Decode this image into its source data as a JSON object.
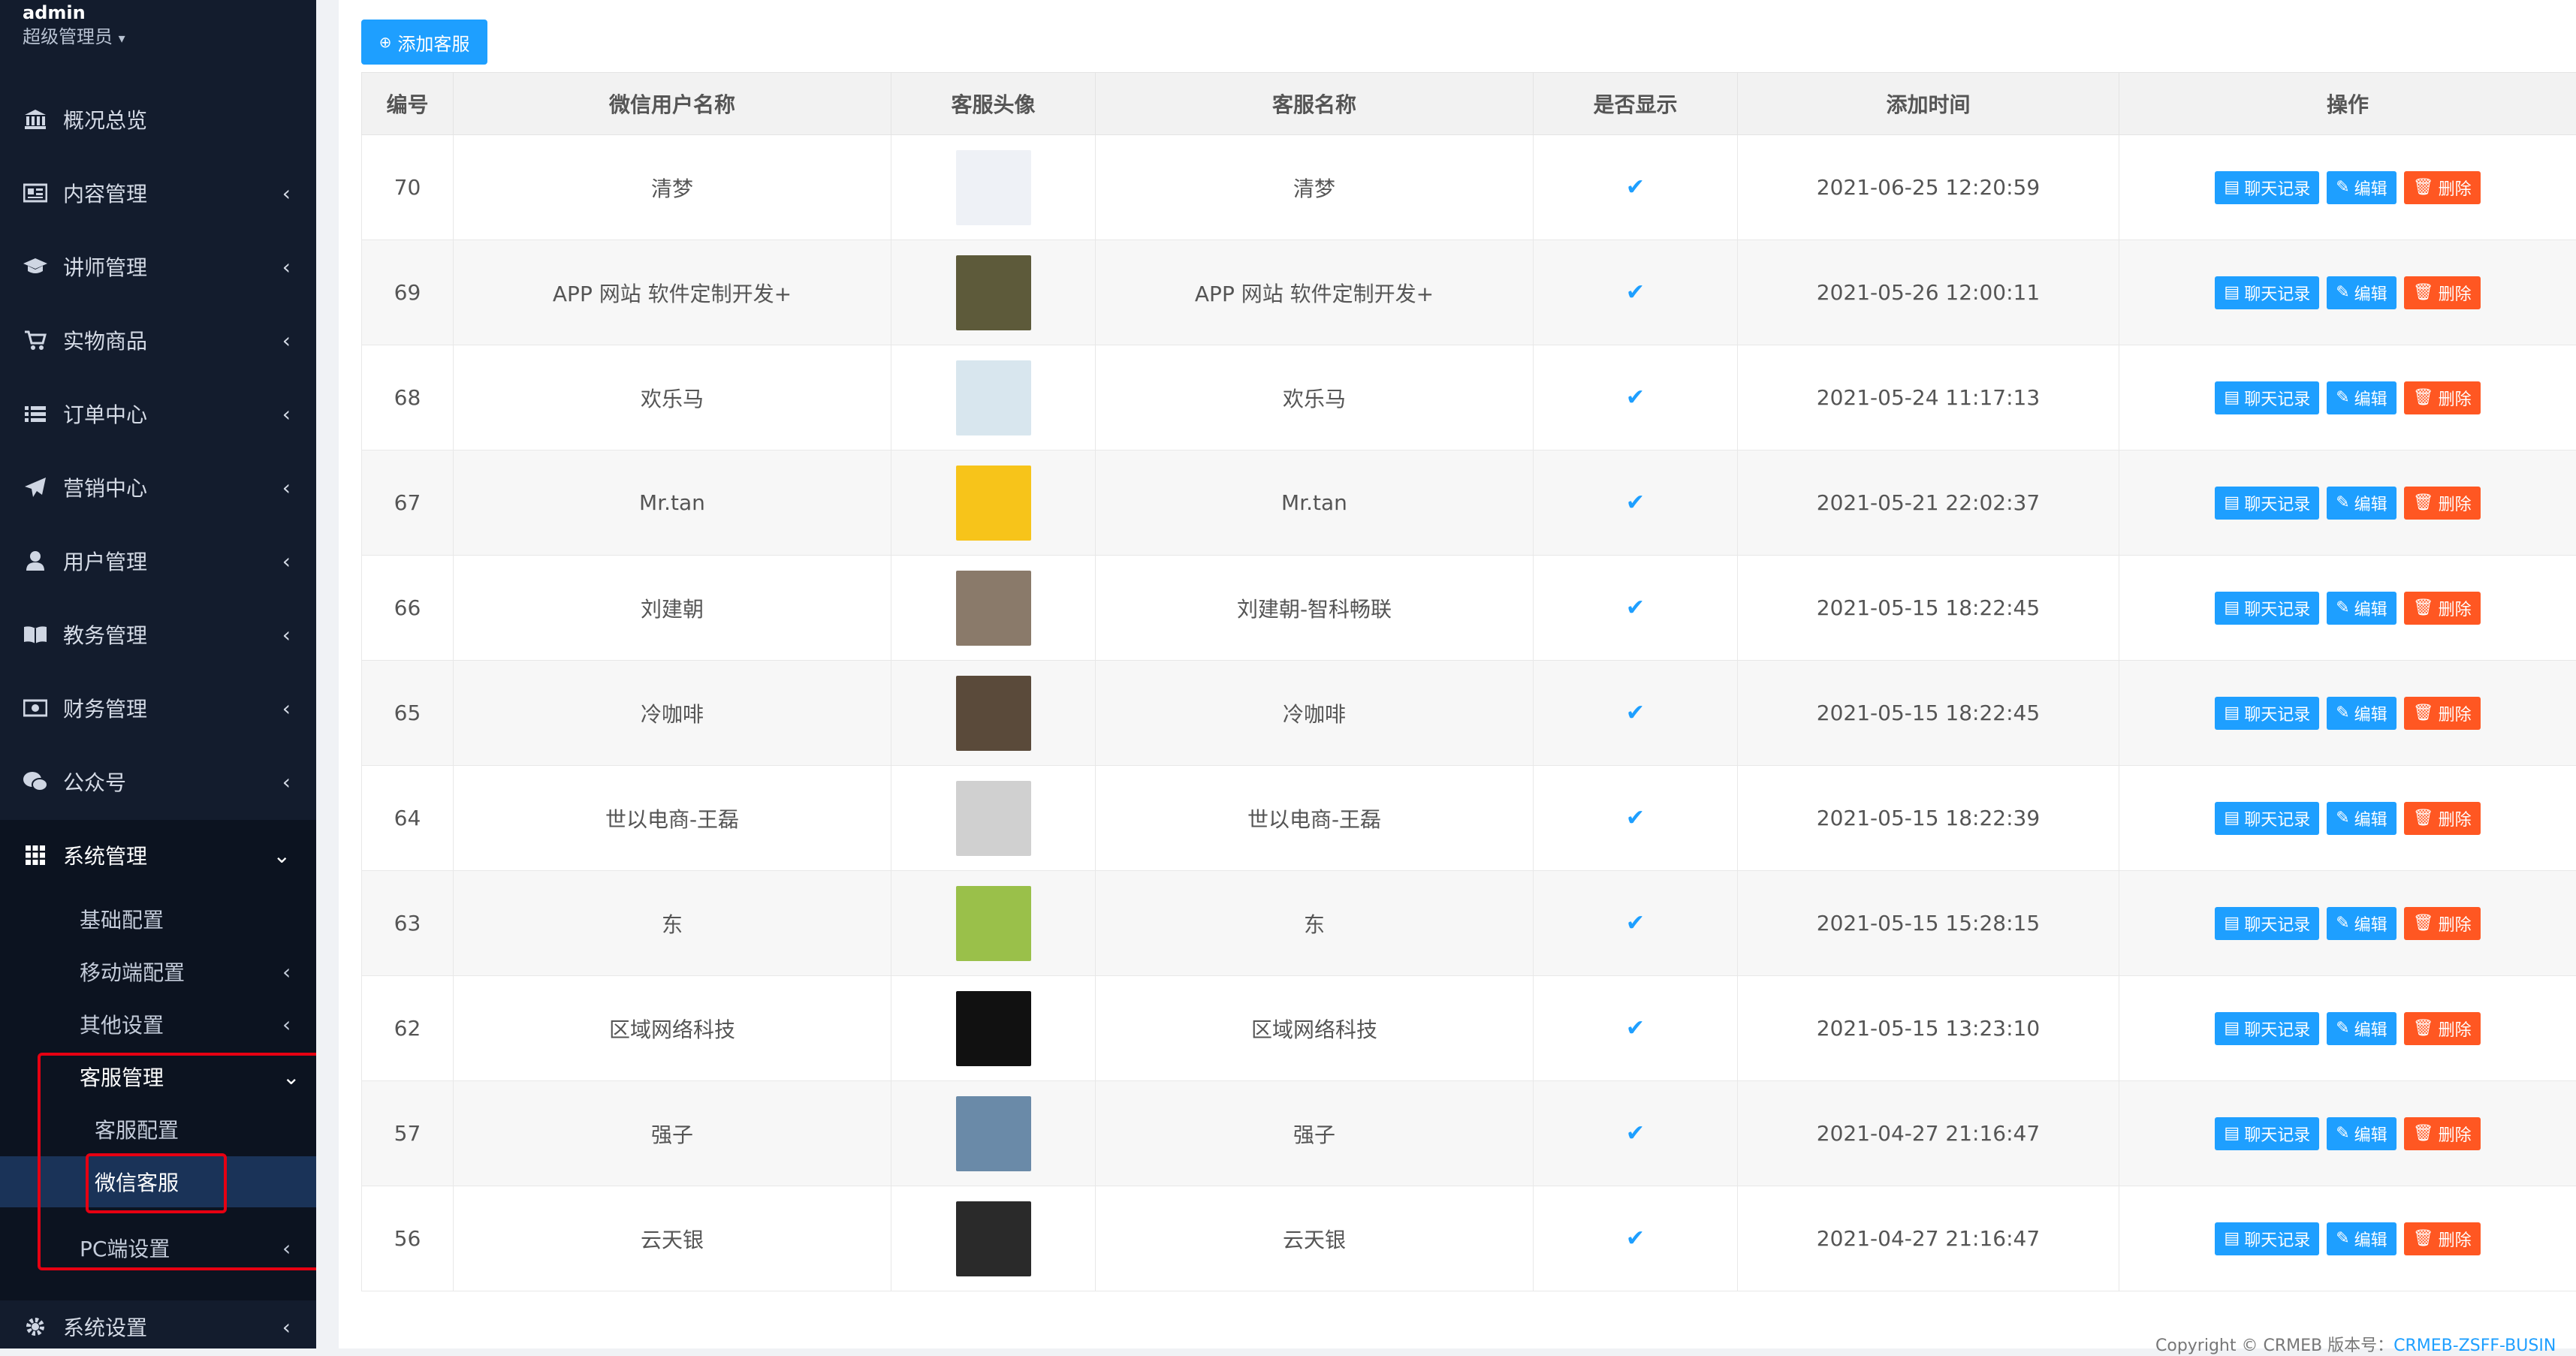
{
  "user": {
    "name": "admin",
    "role": "超级管理员"
  },
  "nav": [
    {
      "label": "概况总览",
      "icon": "bank-icon",
      "chevron": false
    },
    {
      "label": "内容管理",
      "icon": "newspaper-icon",
      "chevron": true
    },
    {
      "label": "讲师管理",
      "icon": "graduation-cap-icon",
      "chevron": true
    },
    {
      "label": "实物商品",
      "icon": "cart-icon",
      "chevron": true
    },
    {
      "label": "订单中心",
      "icon": "list-icon",
      "chevron": true
    },
    {
      "label": "营销中心",
      "icon": "paper-plane-icon",
      "chevron": true
    },
    {
      "label": "用户管理",
      "icon": "user-icon",
      "chevron": true
    },
    {
      "label": "教务管理",
      "icon": "book-icon",
      "chevron": true
    },
    {
      "label": "财务管理",
      "icon": "money-icon",
      "chevron": true
    },
    {
      "label": "公众号",
      "icon": "wechat-icon",
      "chevron": true
    },
    {
      "label": "系统管理",
      "icon": "grid-icon",
      "chevron": true
    },
    {
      "label": "系统设置",
      "icon": "gear-icon",
      "chevron": true
    }
  ],
  "system_sub": [
    {
      "label": "基础配置"
    },
    {
      "label": "移动端配置"
    },
    {
      "label": "其他设置"
    },
    {
      "label": "客服管理"
    },
    {
      "label": "PC端设置"
    }
  ],
  "kefu_sub": [
    {
      "label": "客服配置"
    },
    {
      "label": "微信客服"
    }
  ],
  "toolbar": {
    "add_label": "添加客服"
  },
  "table": {
    "headers": [
      "编号",
      "微信用户名称",
      "客服头像",
      "客服名称",
      "是否显示",
      "添加时间",
      "操作"
    ],
    "rows": [
      {
        "id": "70",
        "wx_name": "清梦",
        "kf_name": "清梦",
        "time": "2021-06-25 12:20:59",
        "avatar_color": "#eef1f6"
      },
      {
        "id": "69",
        "wx_name": "APP 网站 软件定制开发+",
        "kf_name": "APP 网站 软件定制开发+",
        "time": "2021-05-26 12:00:11",
        "avatar_color": "#5d5a3a"
      },
      {
        "id": "68",
        "wx_name": "欢乐马",
        "kf_name": "欢乐马",
        "time": "2021-05-24 11:17:13",
        "avatar_color": "#d8e6ee"
      },
      {
        "id": "67",
        "wx_name": "Mr.tan",
        "kf_name": "Mr.tan",
        "time": "2021-05-21 22:02:37",
        "avatar_color": "#f7c41a"
      },
      {
        "id": "66",
        "wx_name": "刘建朝",
        "kf_name": "刘建朝-智科畅联",
        "time": "2021-05-15 18:22:45",
        "avatar_color": "#8a7a6a"
      },
      {
        "id": "65",
        "wx_name": "冷咖啡",
        "kf_name": "冷咖啡",
        "time": "2021-05-15 18:22:45",
        "avatar_color": "#5a4a3a"
      },
      {
        "id": "64",
        "wx_name": "世以电商-王磊",
        "kf_name": "世以电商-王磊",
        "time": "2021-05-15 18:22:39",
        "avatar_color": "#d0d0d0"
      },
      {
        "id": "63",
        "wx_name": "东",
        "kf_name": "东",
        "time": "2021-05-15 15:28:15",
        "avatar_color": "#9ac04a"
      },
      {
        "id": "62",
        "wx_name": "区域网络科技",
        "kf_name": "区域网络科技",
        "time": "2021-05-15 13:23:10",
        "avatar_color": "#111111"
      },
      {
        "id": "57",
        "wx_name": "强子",
        "kf_name": "强子",
        "time": "2021-04-27 21:16:47",
        "avatar_color": "#6a8aa8"
      },
      {
        "id": "56",
        "wx_name": "云天银",
        "kf_name": "云天银",
        "time": "2021-04-27 21:16:47",
        "avatar_color": "#2a2a2a"
      }
    ],
    "actions": {
      "chat": "聊天记录",
      "edit": "编辑",
      "delete": "删除"
    }
  },
  "footer": {
    "prefix": "Copyright © CRMEB 版本号：",
    "link": "CRMEB-ZSFF-BUSIN"
  },
  "colors": {
    "sidebar_bg": "#131c2d",
    "accent": "#1e9fff",
    "danger": "#ff5722",
    "highlight": "#e60012"
  }
}
